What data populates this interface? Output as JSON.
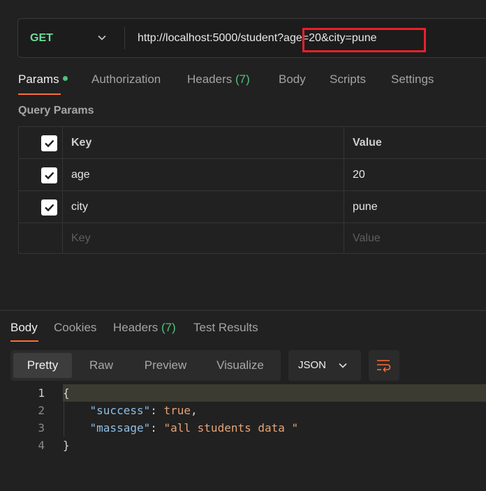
{
  "request": {
    "method": "GET",
    "url": "http://localhost:5000/student?age=20&city=pune"
  },
  "request_tabs": [
    {
      "label": "Params",
      "active": true,
      "has_dot": true
    },
    {
      "label": "Authorization"
    },
    {
      "label": "Headers",
      "count": "(7)"
    },
    {
      "label": "Body"
    },
    {
      "label": "Scripts"
    },
    {
      "label": "Settings"
    }
  ],
  "query_params": {
    "title": "Query Params",
    "columns": {
      "key": "Key",
      "value": "Value"
    },
    "rows": [
      {
        "key": "age",
        "value": "20",
        "checked": true
      },
      {
        "key": "city",
        "value": "pune",
        "checked": true
      }
    ],
    "placeholder": {
      "key": "Key",
      "value": "Value"
    }
  },
  "response_tabs": [
    {
      "label": "Body",
      "active": true
    },
    {
      "label": "Cookies"
    },
    {
      "label": "Headers",
      "count": "(7)"
    },
    {
      "label": "Test Results"
    }
  ],
  "view_modes": [
    "Pretty",
    "Raw",
    "Preview",
    "Visualize"
  ],
  "active_view": "Pretty",
  "format": "JSON",
  "response_body": {
    "line_numbers": [
      "1",
      "2",
      "3",
      "4"
    ],
    "open_brace": "{",
    "close_brace": "}",
    "success_key": "\"success\"",
    "success_value": "true",
    "message_key": "\"massage\"",
    "message_value": "\"all students data \""
  },
  "colors": {
    "accent": "#ff6c37",
    "method_get": "#6bdd9a",
    "count_green": "#4fc27a",
    "highlight_border": "#e8212b"
  },
  "icons": [
    "chevron-down-icon",
    "checkbox-checked-icon",
    "wrap-lines-icon"
  ]
}
